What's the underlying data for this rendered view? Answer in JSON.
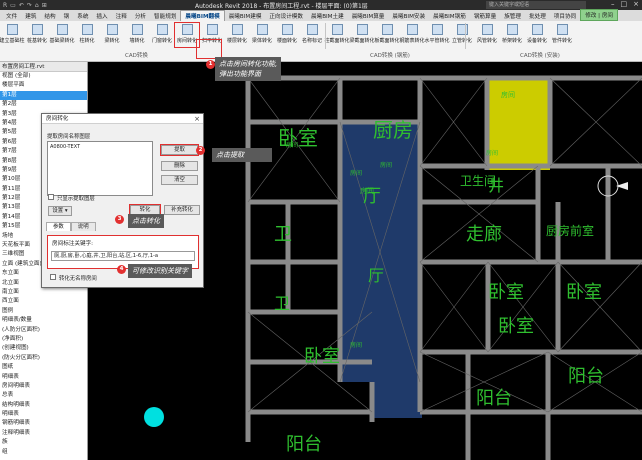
{
  "titlebar": {
    "qat": [
      "R",
      "▭",
      "↶",
      "↷",
      "⌂",
      "⊞"
    ],
    "title": "Autodesk Revit 2018 -   布置房间工程.rvt - 楼层平面: (0)第1层",
    "search": "键入关键字或短语"
  },
  "tabs": [
    {
      "label": "文件",
      "state": "normal"
    },
    {
      "label": "建筑",
      "state": "normal"
    },
    {
      "label": "结构",
      "state": "normal"
    },
    {
      "label": "钢",
      "state": "normal"
    },
    {
      "label": "系统",
      "state": "normal"
    },
    {
      "label": "插入",
      "state": "normal"
    },
    {
      "label": "注释",
      "state": "normal"
    },
    {
      "label": "分析",
      "state": "normal"
    },
    {
      "label": "智能规划",
      "state": "normal"
    },
    {
      "label": "晨曦BIM翻模",
      "state": "active"
    },
    {
      "label": "晨曦BIM建模",
      "state": "normal"
    },
    {
      "label": "正向设计模数",
      "state": "normal"
    },
    {
      "label": "晨曦BIM土建",
      "state": "normal"
    },
    {
      "label": "晨曦BIM算量",
      "state": "normal"
    },
    {
      "label": "晨曦BIM安装",
      "state": "normal"
    },
    {
      "label": "晨曦BIM钢筋",
      "state": "normal"
    },
    {
      "label": "钢筋算量",
      "state": "normal"
    },
    {
      "label": "族管理",
      "state": "normal"
    },
    {
      "label": "批处理",
      "state": "normal"
    },
    {
      "label": "项目协同",
      "state": "normal"
    },
    {
      "label": "修改 | 房间",
      "state": "green"
    }
  ],
  "ribbon": {
    "tools": [
      "建立基础柱",
      "桩基转化",
      "基础梁转化",
      "柱转化",
      "梁转化",
      "墙转化",
      "门窗转化",
      "房间转化",
      "扫平转化",
      "楼层转化",
      "梁体转化",
      "楼面转化",
      "名称标记",
      "柱截面转化",
      "梁截面转化",
      "板截面转化",
      "钢筋表转化",
      "水平管转化",
      "立管转化",
      "风管转化",
      "桥架转化",
      "设备转化",
      "管件转化"
    ],
    "groups": [
      "CAD转换",
      "CAD转换 (钢筋)",
      "CAD转换 (安装)"
    ]
  },
  "browser": {
    "header": "布置房间工程.rvt",
    "rows": [
      "视图 (全部)",
      "楼层平面",
      "第1层",
      "第2层",
      "第3层",
      "第4层",
      "第5层",
      "第6层",
      "第7层",
      "第8层",
      "第9层",
      "第10层",
      "第11层",
      "第12层",
      "第13层",
      "第14层",
      "第15层",
      "场地",
      "天花板平面",
      "三维视图",
      "立面 (建筑立面)",
      "东立面",
      "北立面",
      "南立面",
      "西立面",
      "图例",
      "明细表/数量",
      "(人防分区面积)",
      "(净面积)",
      "(创建视图)",
      "(防火分区面积)",
      "图纸",
      "明细表",
      "房间明细表",
      "总表",
      "结构明细表",
      "明细表",
      "钢筋明细表",
      "注释明细表",
      "族",
      "组"
    ],
    "selected_index": 2
  },
  "canvas": {
    "rooms": [
      {
        "label": "卧室",
        "size": 20
      },
      {
        "label": "厨房",
        "size": 20
      },
      {
        "label": "房间",
        "size": 7
      },
      {
        "label": "卫",
        "size": 18
      },
      {
        "label": "厅",
        "size": 18
      },
      {
        "label": "井",
        "size": 16
      },
      {
        "label": "走廊",
        "size": 18
      },
      {
        "label": "厨房前室",
        "size": 12
      },
      {
        "label": "卧室",
        "size": 18
      },
      {
        "label": "卧室",
        "size": 18
      },
      {
        "label": "阳台",
        "size": 18
      },
      {
        "label": "阳台",
        "size": 18
      },
      {
        "label": "卧室",
        "size": 18
      },
      {
        "label": "阳台",
        "size": 18
      },
      {
        "label": "卫",
        "size": 16
      },
      {
        "label": "厅",
        "size": 16
      },
      {
        "label": "房间",
        "size": 7
      },
      {
        "label": "卧室",
        "size": 18
      },
      {
        "label": "卫生间",
        "size": 12
      }
    ],
    "tags": [
      "房间",
      "房间",
      "房间",
      "房间",
      "房间"
    ]
  },
  "dialog": {
    "title": "房间转化",
    "layer_label": "提取房间名称图层",
    "layer_value": "A0800-TEXT",
    "btn_extract": "提取",
    "btn_delete": "删除",
    "btn_clear": "清空",
    "only_show": "只显示提取图层",
    "settings": "设置 ▾",
    "btn_convert": "转化",
    "btn_supplement": "补充转化",
    "tab_params": "参数",
    "tab_help": "说明",
    "kw_label": "房间标注关键字:",
    "kw_value": "厕,厨,房,卧,心庭,井,卫,阳台,站,区,1-6,厅,1-a",
    "convert_name": "转化无名称房间"
  },
  "annotations": {
    "step1": "1",
    "step2": "2",
    "step3": "3",
    "step4": "4",
    "callout1_line1": "点击房间转化功能,",
    "callout1_line2": "弹出功能界面",
    "callout2": "点击提取",
    "callout3": "点击转化",
    "callout4": "可修改识别关键字"
  },
  "colors": {
    "accent_red": "#e03030",
    "room_blue": "#1f3a6a",
    "room_yellow": "#cccc00",
    "cad_green": "#2fbf2f",
    "wall_gray": "#8a8a8a"
  }
}
